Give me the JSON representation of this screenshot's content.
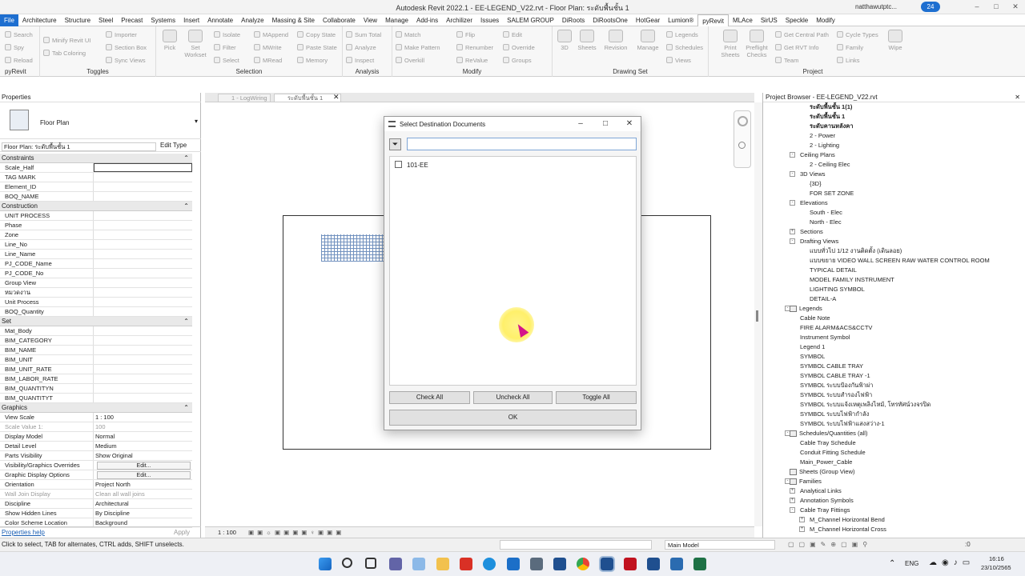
{
  "window": {
    "title": "Autodesk Revit 2022.1 - EE-LEGEND_V22.rvt - Floor Plan: ระดับพื้นชั้น 1",
    "user": "natthawutptc...",
    "badge": "24"
  },
  "menu": [
    "File",
    "Architecture",
    "Structure",
    "Steel",
    "Precast",
    "Systems",
    "Insert",
    "Annotate",
    "Analyze",
    "Massing & Site",
    "Collaborate",
    "View",
    "Manage",
    "Add-ins",
    "Archilizer",
    "Issues",
    "SALEM GROUP",
    "DiRoots",
    "DiRootsOne",
    "HotGear",
    "Lumion®",
    "pyRevit",
    "MLAce",
    "SirUS",
    "Speckle",
    "Modify"
  ],
  "ribbon": {
    "pyrevit_items": [
      "Search",
      "Spy",
      "Reload"
    ],
    "pyrevit_label": "pyRevit",
    "toggles_items": [
      "Minify Revit UI",
      "Tab Coloring",
      "Importer",
      "Section Box",
      "Sync Views"
    ],
    "toggles_label": "Toggles",
    "selection_items": [
      "Pick",
      "Set Workset",
      "Isolate",
      "Filter",
      "Select",
      "MAppend",
      "MWrite",
      "MRead",
      "Copy State",
      "Paste State",
      "Memory"
    ],
    "selection_label": "Selection",
    "analysis_items": [
      "Sum Total",
      "Analyze",
      "Inspect"
    ],
    "analysis_label": "Analysis",
    "modify_items": [
      "Match",
      "Make Pattern",
      "Overkill",
      "Flip",
      "Renumber",
      "ReValue",
      "Edit",
      "Override",
      "Groups"
    ],
    "modify_label": "Modify",
    "drawing_items": [
      "3D",
      "Sheets",
      "Revision",
      "Manage",
      "Legends",
      "Schedules",
      "Views"
    ],
    "drawing_label": "Drawing Set",
    "project_items": [
      "Print Sheets",
      "Preflight Checks",
      "Get Central Path",
      "Get RVT Info",
      "Team",
      "Cycle Types",
      "Family",
      "Links",
      "Wipe"
    ],
    "project_label": "Project"
  },
  "properties": {
    "header": "Properties",
    "type_name": "Floor Plan",
    "instance": "Floor Plan: ระดับพื้นชั้น 1",
    "edit_type": "Edit Type",
    "groups": [
      {
        "name": "Constraints",
        "rows": [
          [
            "Scale_Half",
            ""
          ],
          [
            "TAG MARK",
            ""
          ],
          [
            "Element_ID",
            ""
          ],
          [
            "BOQ_NAME",
            ""
          ]
        ]
      },
      {
        "name": "Construction",
        "rows": [
          [
            "UNIT PROCESS",
            ""
          ],
          [
            "Phase",
            ""
          ],
          [
            "Zone",
            ""
          ],
          [
            "Line_No",
            ""
          ],
          [
            "Line_Name",
            ""
          ],
          [
            "PJ_CODE_Name",
            ""
          ],
          [
            "PJ_CODE_No",
            ""
          ],
          [
            "Group View",
            ""
          ],
          [
            "หมวดงาน",
            ""
          ],
          [
            "Unit Process",
            ""
          ],
          [
            "BOQ_Quantity",
            ""
          ]
        ]
      },
      {
        "name": "Set",
        "rows": [
          [
            "Mat_Body",
            ""
          ],
          [
            "BIM_CATEGORY",
            ""
          ],
          [
            "BIM_NAME",
            ""
          ],
          [
            "BIM_UNIT",
            ""
          ],
          [
            "BIM_UNIT_RATE",
            ""
          ],
          [
            "BIM_LABOR_RATE",
            ""
          ],
          [
            "BIM_QUANTITYN",
            ""
          ],
          [
            "BIM_QUANTITYT",
            ""
          ]
        ]
      },
      {
        "name": "Graphics",
        "rows": [
          [
            "View Scale",
            "1 : 100"
          ],
          [
            "Scale Value 1:",
            "100"
          ],
          [
            "Display Model",
            "Normal"
          ],
          [
            "Detail Level",
            "Medium"
          ],
          [
            "Parts Visibility",
            "Show Original"
          ],
          [
            "Visibility/Graphics Overrides",
            "Edit..."
          ],
          [
            "Graphic Display Options",
            "Edit..."
          ],
          [
            "Orientation",
            "Project North"
          ],
          [
            "Wall Join Display",
            "Clean all wall joins"
          ],
          [
            "Discipline",
            "Architectural"
          ],
          [
            "Show Hidden Lines",
            "By Discipline"
          ],
          [
            "Color Scheme Location",
            "Background"
          ]
        ]
      }
    ],
    "help_link": "Properties help",
    "apply": "Apply"
  },
  "doc_tabs": [
    "1 - LogWiring",
    "ระดับพื้นชั้น 1"
  ],
  "view_scale": "1 : 100",
  "project_browser": {
    "header": "Project Browser - EE-LEGEND_V22.rvt",
    "nodes": [
      {
        "text": "ระดับพื้นชั้น 1(1)",
        "level": 3,
        "bold": true
      },
      {
        "text": "ระดับพื้นชั้น 1",
        "level": 3,
        "bold": true
      },
      {
        "text": "ระดับคานหลังคา",
        "level": 3,
        "bold": true
      },
      {
        "text": "2 - Power",
        "level": 3
      },
      {
        "text": "2 - Lighting",
        "level": 3
      },
      {
        "text": "Ceiling Plans",
        "level": 2,
        "exp": "-"
      },
      {
        "text": "2 - Ceiling Elec",
        "level": 3
      },
      {
        "text": "3D Views",
        "level": 2,
        "exp": "-"
      },
      {
        "text": "{3D}",
        "level": 3
      },
      {
        "text": "FOR SET ZONE",
        "level": 3
      },
      {
        "text": "Elevations",
        "level": 2,
        "exp": "-"
      },
      {
        "text": "South - Elec",
        "level": 3
      },
      {
        "text": "North - Elec",
        "level": 3
      },
      {
        "text": "Sections",
        "level": 2,
        "exp": "+"
      },
      {
        "text": "Drafting Views",
        "level": 2,
        "exp": "-"
      },
      {
        "text": "แบบทั่วไป 1/12 งานติดตั้ง (เดินลอย)",
        "level": 3
      },
      {
        "text": "แบบขยาย VIDEO WALL SCREEN RAW WATER CONTROL ROOM",
        "level": 3
      },
      {
        "text": "TYPICAL DETAIL",
        "level": 3
      },
      {
        "text": "MODEL FAMILY INSTRUMENT",
        "level": 3
      },
      {
        "text": "LIGHTING SYMBOL",
        "level": 3
      },
      {
        "text": "DETAIL-A",
        "level": 3
      },
      {
        "text": "Legends",
        "level": 1,
        "exp": "-",
        "icon": true
      },
      {
        "text": "Cable Note",
        "level": 2
      },
      {
        "text": "FIRE ALARM&ACS&CCTV",
        "level": 2
      },
      {
        "text": "Instrument Symbol",
        "level": 2
      },
      {
        "text": "Legend 1",
        "level": 2
      },
      {
        "text": "SYMBOL",
        "level": 2
      },
      {
        "text": "SYMBOL CABLE TRAY",
        "level": 2
      },
      {
        "text": "SYMBOL CABLE TRAY -1",
        "level": 2
      },
      {
        "text": "SYMBOL ระบบป้องกันฟ้าผ่า",
        "level": 2
      },
      {
        "text": "SYMBOL ระบบสำรองไฟฟ้า",
        "level": 2
      },
      {
        "text": "SYMBOL ระบบแจ้งเหตุเพลิงไหม้, โทรทัศน์วงจรปิด",
        "level": 2
      },
      {
        "text": "SYMBOL ระบบไฟฟ้ากำลัง",
        "level": 2
      },
      {
        "text": "SYMBOL ระบบไฟฟ้าแสงสว่าง-1",
        "level": 2
      },
      {
        "text": "Schedules/Quantities (all)",
        "level": 1,
        "exp": "-",
        "icon": true
      },
      {
        "text": "Cable Tray Schedule",
        "level": 2
      },
      {
        "text": "Conduit Fitting Schedule",
        "level": 2
      },
      {
        "text": "Main_Power_Cable",
        "level": 2
      },
      {
        "text": "Sheets (Group View)",
        "level": 1,
        "icon": true
      },
      {
        "text": "Families",
        "level": 1,
        "exp": "-",
        "icon": true
      },
      {
        "text": "Analytical Links",
        "level": 2,
        "exp": "+"
      },
      {
        "text": "Annotation Symbols",
        "level": 2,
        "exp": "+"
      },
      {
        "text": "Cable Tray Fittings",
        "level": 2,
        "exp": "-"
      },
      {
        "text": "M_Channel Horizontal Bend",
        "level": 3,
        "exp": "+"
      },
      {
        "text": "M_Channel Horizontal Cross",
        "level": 3,
        "exp": "+"
      }
    ]
  },
  "status": {
    "hint": "Click to select, TAB for alternates, CTRL adds, SHIFT unselects.",
    "model": "Main Model",
    "value": ":0"
  },
  "dialog": {
    "title": "Select Destination Documents",
    "search_placeholder": "",
    "items": [
      {
        "label": "101-EE",
        "checked": false
      }
    ],
    "check_all": "Check All",
    "uncheck_all": "Uncheck All",
    "toggle_all": "Toggle All",
    "ok": "OK"
  },
  "taskbar": {
    "lang": "ENG",
    "time": "16:16",
    "date": "23/10/2565"
  },
  "colors": {
    "file_tab": "#1e6fd0",
    "cursor": "#d4148a",
    "highlight": "#fff06a",
    "accent": "#7fa6d6"
  }
}
